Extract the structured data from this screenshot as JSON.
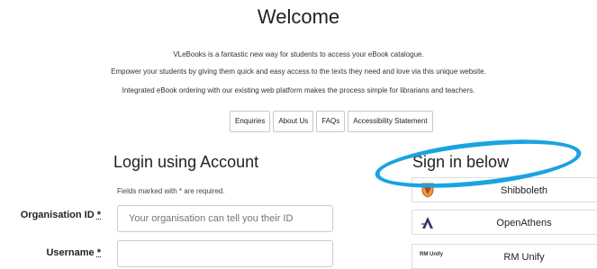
{
  "header": {
    "title": "Welcome",
    "intro_lines": [
      "VLeBooks is a fantastic new way for students to access your eBook catalogue.",
      "Empower your students by giving them quick and easy access to the texts they need and love via this unique website.",
      "Integrated eBook ordering with our existing web platform makes the process simple for librarians and teachers."
    ]
  },
  "nav": {
    "items": [
      "Enquiries",
      "About Us",
      "FAQs",
      "Accessibility Statement"
    ]
  },
  "login": {
    "heading": "Login using Account",
    "required_note": "Fields marked with * are required.",
    "org_label": "Organisation ID",
    "org_placeholder": "Your organisation can tell you their ID",
    "username_label": "Username",
    "required_marker": "*"
  },
  "signin": {
    "heading": "Sign in below",
    "highlight_color": "#1aa3e0",
    "providers": [
      {
        "label": "Shibboleth",
        "icon": "shibboleth-icon"
      },
      {
        "label": "OpenAthens",
        "icon": "openathens-icon"
      },
      {
        "label": "RM Unify",
        "icon": "rm-unify-icon",
        "icon_text": "RM Unify"
      }
    ]
  }
}
